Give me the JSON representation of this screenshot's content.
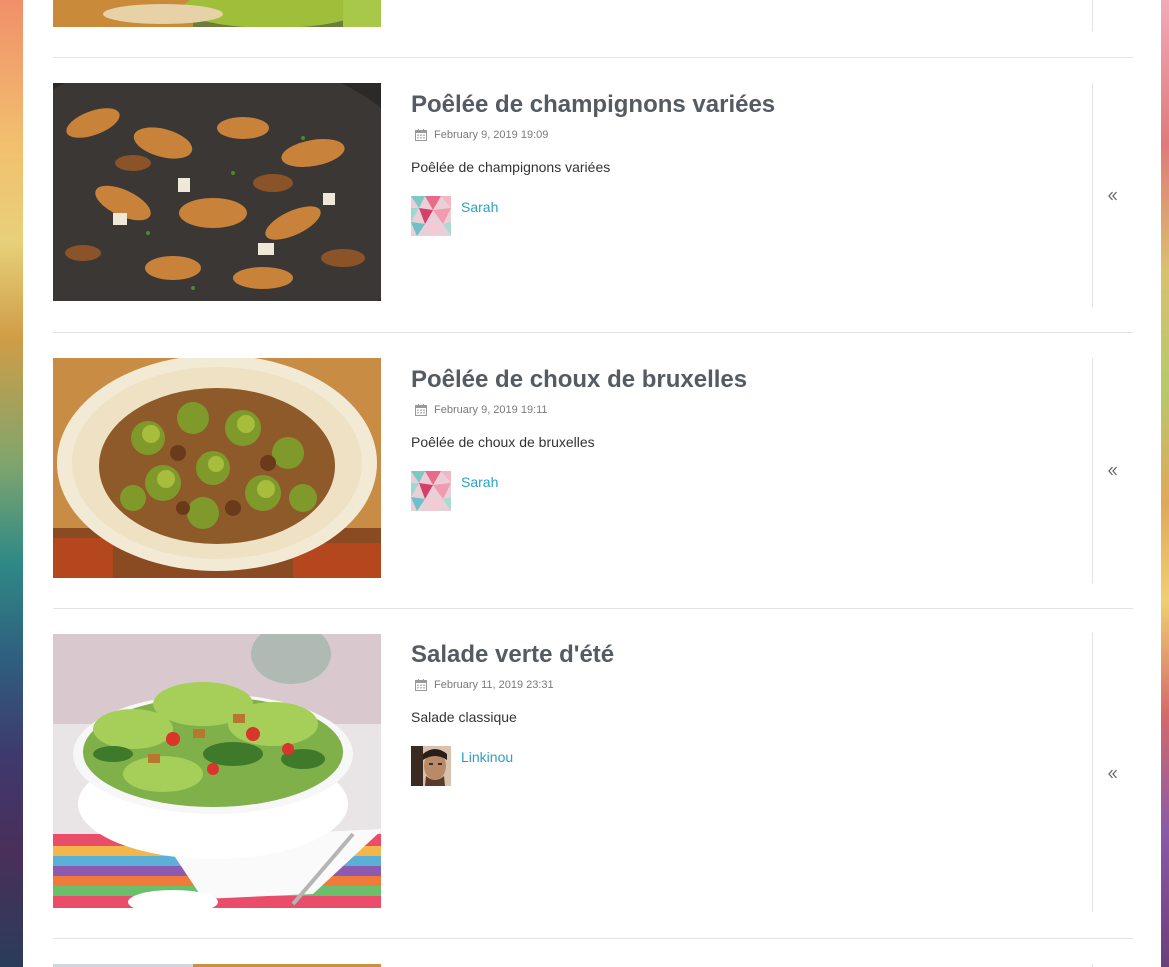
{
  "recipes": [
    {
      "title": "Poêlée de champignons variées",
      "date": "February 9, 2019 19:09",
      "description": "Poêlée de champignons variées",
      "author": "Sarah"
    },
    {
      "title": "Poêlée de choux de bruxelles",
      "date": "February 9, 2019 19:11",
      "description": "Poêlée de choux de bruxelles",
      "author": "Sarah"
    },
    {
      "title": "Salade verte d'été",
      "date": "February 11, 2019 23:31",
      "description": "Salade classique",
      "author": "Linkinou"
    }
  ],
  "icons": {
    "date": "calendar-icon",
    "collapse": "double-chevron-left-icon"
  },
  "colors": {
    "link": "#2aa2c7",
    "title": "#555b63",
    "divider": "#e3e3e3"
  }
}
